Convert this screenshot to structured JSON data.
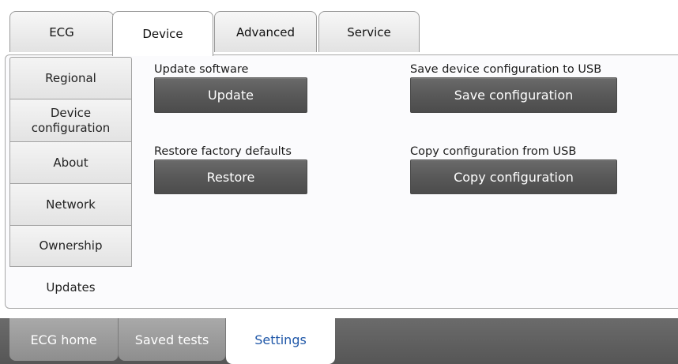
{
  "top_tabs": [
    {
      "label": "ECG",
      "active": false
    },
    {
      "label": "Device",
      "active": true
    },
    {
      "label": "Advanced",
      "active": false
    },
    {
      "label": "Service",
      "active": false
    }
  ],
  "sidebar": {
    "items": [
      {
        "label": "Regional",
        "active": false
      },
      {
        "label": "Device configuration",
        "active": false
      },
      {
        "label": "About",
        "active": false
      },
      {
        "label": "Network",
        "active": false
      },
      {
        "label": "Ownership",
        "active": false
      },
      {
        "label": "Updates",
        "active": true
      }
    ]
  },
  "settings": {
    "update": {
      "label": "Update software",
      "button": "Update"
    },
    "restore": {
      "label": "Restore factory defaults",
      "button": "Restore"
    },
    "save": {
      "label": "Save device configuration to USB",
      "button": "Save configuration"
    },
    "copy": {
      "label": "Copy configuration from USB",
      "button": "Copy configuration"
    }
  },
  "bottom_nav": [
    {
      "label": "ECG home",
      "active": false
    },
    {
      "label": "Saved tests",
      "active": false
    },
    {
      "label": "Settings",
      "active": true
    }
  ],
  "colors": {
    "button_bg": "#5a5a5a",
    "bottom_bar_bg": "#5f5f5f",
    "active_nav_text": "#1f57a8",
    "panel_bg": "#fbfbfd"
  }
}
